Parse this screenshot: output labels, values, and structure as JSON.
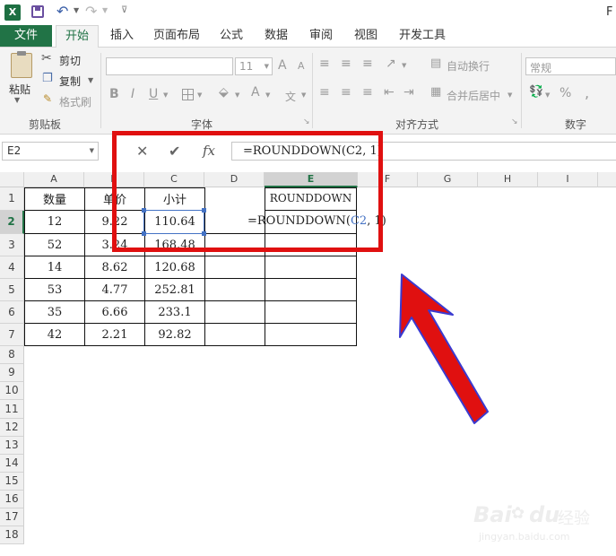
{
  "titlebar": {
    "app_icon": "excel-icon",
    "right_initial": "F"
  },
  "tabs": [
    {
      "label": "文件",
      "active": false,
      "file": true
    },
    {
      "label": "开始",
      "active": true
    },
    {
      "label": "插入"
    },
    {
      "label": "页面布局"
    },
    {
      "label": "公式"
    },
    {
      "label": "数据"
    },
    {
      "label": "审阅"
    },
    {
      "label": "视图"
    },
    {
      "label": "开发工具"
    }
  ],
  "ribbon": {
    "clipboard": {
      "paste": "粘贴",
      "cut": "剪切",
      "copy": "复制",
      "format_painter": "格式刷",
      "group": "剪贴板"
    },
    "font": {
      "size": "11",
      "bold": "B",
      "italic": "I",
      "underline": "U",
      "grow": "A",
      "shrink": "A",
      "color": "A",
      "phonetic": "文",
      "group": "字体"
    },
    "alignment": {
      "wrap": "自动换行",
      "merge": "合并后居中",
      "group": "对齐方式"
    },
    "number": {
      "format": "常规",
      "percent": "%",
      "comma": ",",
      "group": "数字"
    }
  },
  "formula_bar": {
    "name_box": "E2",
    "cancel": "✕",
    "enter": "✔",
    "fx": "fx",
    "formula": "=ROUNDDOWN(C2, 1)"
  },
  "columns": [
    "A",
    "B",
    "C",
    "D",
    "E",
    "F",
    "G",
    "H",
    "I"
  ],
  "rows": [
    "1",
    "2",
    "3",
    "4",
    "5",
    "6",
    "7",
    "8",
    "9",
    "10",
    "11",
    "12",
    "13",
    "14",
    "15",
    "16",
    "17",
    "18"
  ],
  "sheet": {
    "headers": {
      "a": "数量",
      "b": "单价",
      "c": "小计",
      "e": "ROUNDDOWN"
    },
    "data": [
      {
        "a": "12",
        "b": "9.22",
        "c": "110.64"
      },
      {
        "a": "52",
        "b": "3.24",
        "c": "168.48"
      },
      {
        "a": "14",
        "b": "8.62",
        "c": "120.68"
      },
      {
        "a": "53",
        "b": "4.77",
        "c": "252.81"
      },
      {
        "a": "35",
        "b": "6.66",
        "c": "233.1"
      },
      {
        "a": "42",
        "b": "2.21",
        "c": "92.82"
      }
    ],
    "e2_prefix": "=ROUNDDOWN(",
    "e2_ref": "C2",
    "e2_suffix": ", 1)"
  },
  "watermark": {
    "brand": "Bai",
    "brand2": "du",
    "cn": "经验",
    "url": "jingyan.baidu.com"
  },
  "colors": {
    "excel_green": "#217346",
    "highlight_red": "#e01010",
    "ref_blue": "#4472c4"
  }
}
